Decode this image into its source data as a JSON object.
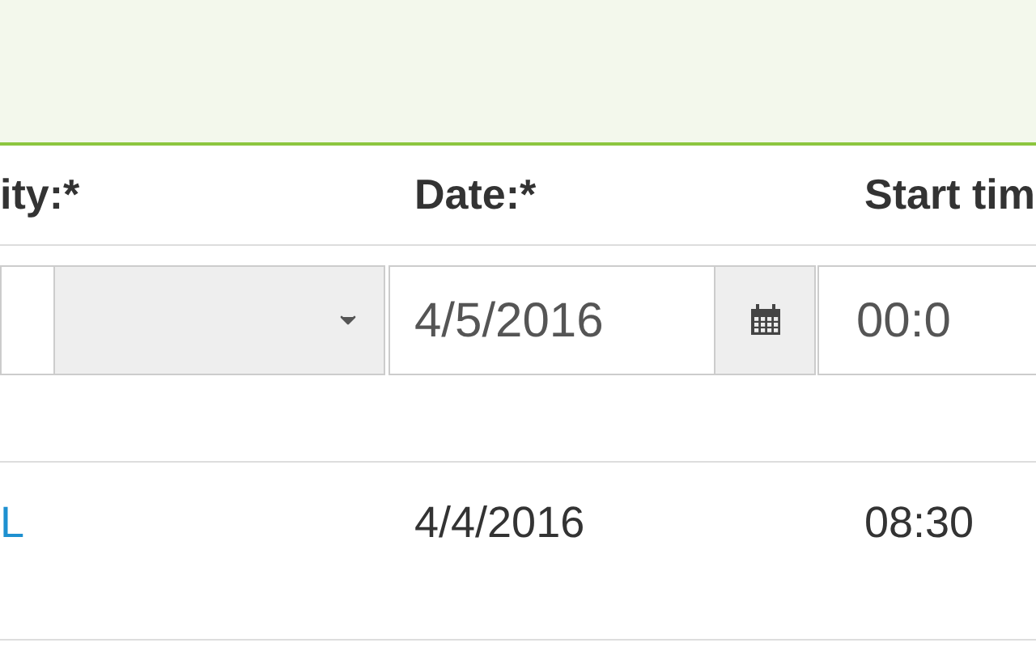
{
  "table": {
    "columns": [
      "ity:*",
      "Date:*",
      "Start tim"
    ],
    "form_row": {
      "date": {
        "value": "4/5/2016"
      },
      "time": {
        "value": "00:0"
      }
    },
    "rows": [
      {
        "cells": [
          "L",
          "4/4/2016",
          "08:30"
        ]
      }
    ]
  }
}
